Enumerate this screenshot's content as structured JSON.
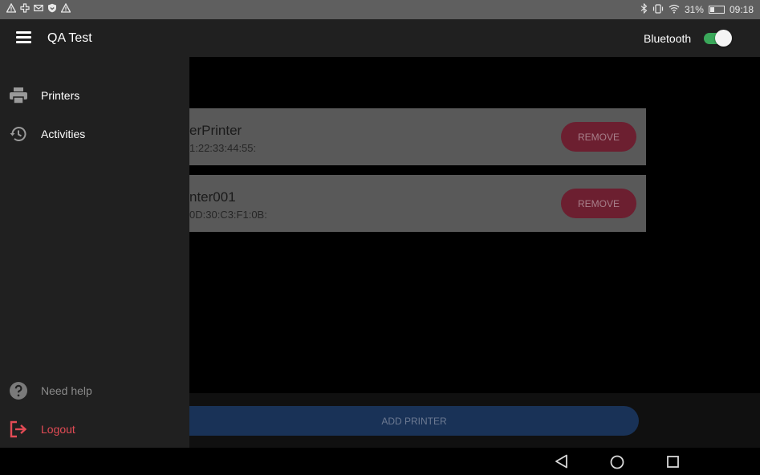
{
  "status_bar": {
    "battery": "31%",
    "battery_level": 0.31,
    "time": "09:18",
    "left_icons": [
      "warning-icon",
      "gamepad-icon",
      "mail-icon",
      "shield-icon",
      "warning-icon"
    ],
    "right_icons": [
      "bluetooth-icon",
      "vibrate-icon",
      "wifi-icon",
      "battery-icon"
    ]
  },
  "app_bar": {
    "title": "QA Test",
    "bluetooth_label": "Bluetooth",
    "bluetooth_enabled": true,
    "toggle_color": "#3aa85a"
  },
  "drawer": {
    "items": [
      {
        "label": "Printers",
        "icon": "printer-icon"
      },
      {
        "label": "Activities",
        "icon": "history-icon"
      }
    ],
    "help_label": "Need help",
    "help_icon": "help-circle-icon",
    "logout_label": "Logout",
    "logout_icon": "logout-icon",
    "logout_color": "#e24b55"
  },
  "printers": [
    {
      "name": "erPrinter",
      "address": "1:22:33:44:55:",
      "remove_label": "REMOVE"
    },
    {
      "name": "nter001",
      "address": "0D:30:C3:F1:0B:",
      "remove_label": "REMOVE"
    }
  ],
  "add_printer_label": "ADD PRINTER",
  "colors": {
    "remove_button": "#c8284e",
    "add_button": "#2c63b8"
  }
}
